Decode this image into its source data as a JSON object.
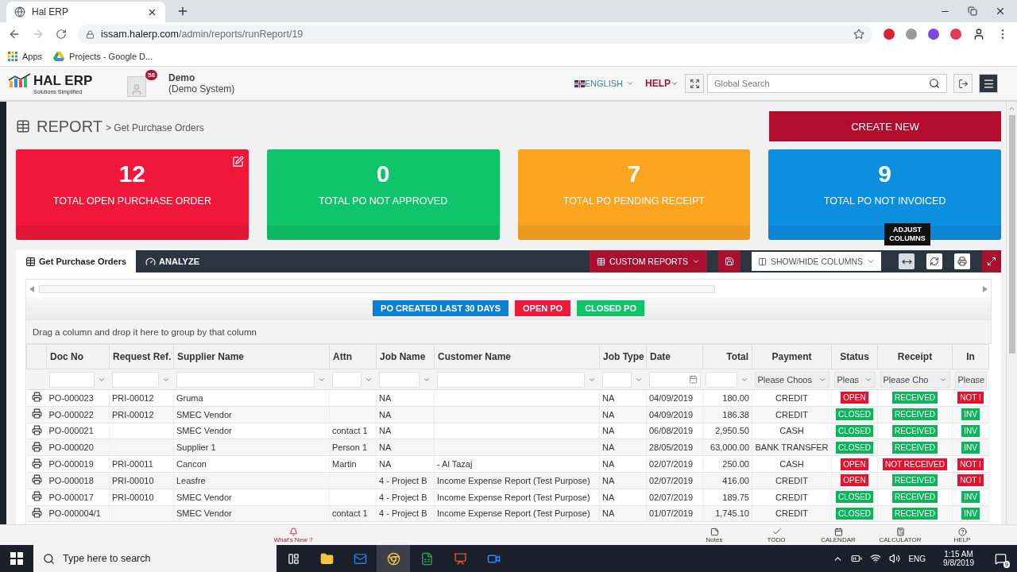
{
  "browser": {
    "tab_title": "Hal ERP",
    "url_host": "issam.halerp.com",
    "url_path": "/admin/reports/runReport/19",
    "bookmarks": [
      "Apps",
      "Projects - Google D..."
    ]
  },
  "header": {
    "logo": "HAL ERP",
    "logo_tagline": "Solutions Simplified",
    "notification_count": "58",
    "user_name": "Demo",
    "user_system": "(Demo System)",
    "language": "ENGLISH",
    "help": "HELP",
    "search": {
      "placeholder": "Global Search"
    }
  },
  "page": {
    "title": "REPORT",
    "breadcrumb": "> Get Purchase Orders",
    "create_button": "CREATE NEW"
  },
  "cards": [
    {
      "value": "12",
      "label": "TOTAL OPEN PURCHASE ORDER",
      "color": "#f0173a",
      "editable": true
    },
    {
      "value": "0",
      "label": "TOTAL PO NOT APPROVED",
      "color": "#0fc46a",
      "editable": false
    },
    {
      "value": "7",
      "label": "TOTAL PO PENDING RECEIPT",
      "color": "#fba41f",
      "editable": false
    },
    {
      "value": "9",
      "label": "TOTAL PO NOT INVOICED",
      "color": "#0d8fe0",
      "editable": false
    }
  ],
  "tabs": [
    {
      "label": "Get Purchase Orders",
      "selected": true
    },
    {
      "label": "ANALYZE",
      "selected": false
    }
  ],
  "toolbar": {
    "custom_reports": "CUSTOM REPORTS",
    "show_hide": "SHOW/HIDE COLUMNS",
    "tooltip": "ADJUST COLUMNS"
  },
  "quick_filters": [
    {
      "label": "PO CREATED LAST 30 DAYS",
      "color": "#0b7fd4"
    },
    {
      "label": "OPEN PO",
      "color": "#f0173a"
    },
    {
      "label": "CLOSED PO",
      "color": "#0fc46a"
    }
  ],
  "group_hint": "Drag a column and drop it here to group by that column",
  "columns": [
    {
      "label": "Doc No",
      "kind": "text",
      "filter": {
        "kind": "text"
      }
    },
    {
      "label": "Request Ref.",
      "kind": "text",
      "filter": {
        "kind": "text"
      }
    },
    {
      "label": "Supplier Name",
      "kind": "text",
      "filter": {
        "kind": "text"
      }
    },
    {
      "label": "Attn",
      "kind": "text",
      "filter": {
        "kind": "text"
      }
    },
    {
      "label": "Job Name",
      "kind": "text",
      "filter": {
        "kind": "text"
      }
    },
    {
      "label": "Customer Name",
      "kind": "text",
      "filter": {
        "kind": "text"
      }
    },
    {
      "label": "Job Type",
      "kind": "text",
      "filter": {
        "kind": "text"
      }
    },
    {
      "label": "Date",
      "kind": "text",
      "filter": {
        "kind": "date"
      }
    },
    {
      "label": "Total",
      "kind": "amount",
      "filter": {
        "kind": "text"
      }
    },
    {
      "label": "Payment",
      "kind": "choice",
      "filter": {
        "kind": "select",
        "placeholder": "Please Choos"
      }
    },
    {
      "label": "Status",
      "kind": "badge",
      "filter": {
        "kind": "select",
        "placeholder": "Pleas"
      }
    },
    {
      "label": "Receipt",
      "kind": "badge",
      "filter": {
        "kind": "select",
        "placeholder": "Please Cho"
      }
    },
    {
      "label": "In",
      "kind": "badge",
      "filter": {
        "kind": "select",
        "placeholder": "Please"
      }
    }
  ],
  "rows": [
    [
      "PO-000023",
      "PRI-00012",
      "Gruma",
      null,
      "NA",
      null,
      "NA",
      "04/09/2019",
      "180.00",
      "CREDIT",
      {
        "label": "OPEN",
        "color": "#e8112d"
      },
      {
        "label": "RECEIVED",
        "color": "#0db45b"
      },
      {
        "label": "NOT I",
        "color": "#e8112d"
      }
    ],
    [
      "PO-000022",
      "PRI-00012",
      "SMEC Vendor",
      null,
      "NA",
      null,
      "NA",
      "04/09/2019",
      "186.38",
      "CREDIT",
      {
        "label": "CLOSED",
        "color": "#0db45b"
      },
      {
        "label": "RECEIVED",
        "color": "#0db45b"
      },
      {
        "label": "INV",
        "color": "#0db45b"
      }
    ],
    [
      "PO-000021",
      null,
      "SMEC Vendor",
      "contact 1",
      "NA",
      null,
      "NA",
      "06/08/2019",
      "2,950.50",
      "CASH",
      {
        "label": "CLOSED",
        "color": "#0db45b"
      },
      {
        "label": "RECEIVED",
        "color": "#0db45b"
      },
      {
        "label": "INV",
        "color": "#0db45b"
      }
    ],
    [
      "PO-000020",
      null,
      "Supplier 1",
      "Person 1",
      "NA",
      null,
      "NA",
      "28/05/2019",
      "63,000.00",
      "BANK TRANSFER",
      {
        "label": "CLOSED",
        "color": "#0db45b"
      },
      {
        "label": "RECEIVED",
        "color": "#0db45b"
      },
      {
        "label": "INV",
        "color": "#0db45b"
      }
    ],
    [
      "PO-000019",
      "PRI-00011",
      "Cancon",
      "Martin",
      "NA",
      "- Al Tazaj",
      "NA",
      "02/07/2019",
      "250.00",
      "CASH",
      {
        "label": "OPEN",
        "color": "#e8112d"
      },
      {
        "label": "NOT RECEIVED",
        "color": "#e8112d"
      },
      {
        "label": "NOT I",
        "color": "#e8112d"
      }
    ],
    [
      "PO-000018",
      "PRI-00010",
      "Leasfre",
      null,
      "4 - Project B",
      "Income Expense Report (Test Purpose)",
      "NA",
      "02/07/2019",
      "416.00",
      "CREDIT",
      {
        "label": "OPEN",
        "color": "#e8112d"
      },
      {
        "label": "RECEIVED",
        "color": "#0db45b"
      },
      {
        "label": "NOT I",
        "color": "#e8112d"
      }
    ],
    [
      "PO-000017",
      "PRI-00010",
      "SMEC Vendor",
      null,
      "4 - Project B",
      "Income Expense Report (Test Purpose)",
      "NA",
      "02/07/2019",
      "189.75",
      "CREDIT",
      {
        "label": "CLOSED",
        "color": "#0db45b"
      },
      {
        "label": "RECEIVED",
        "color": "#0db45b"
      },
      {
        "label": "INV",
        "color": "#0db45b"
      }
    ],
    [
      "PO-000004/1",
      null,
      "SMEC Vendor",
      "contact 1",
      "4 - Project B",
      "Income Expense Report (Test Purpose)",
      "NA",
      "01/07/2019",
      "1,745.10",
      "CREDIT",
      {
        "label": "CLOSED",
        "color": "#0db45b"
      },
      {
        "label": "RECEIVED",
        "color": "#0db45b"
      },
      {
        "label": "INV",
        "color": "#0db45b"
      }
    ]
  ],
  "bottom_bar": {
    "whats_new": "What's New ?",
    "tools": [
      "Notes",
      "TODO",
      "CALENDAR",
      "CALCULATOR",
      "HELP"
    ]
  },
  "taskbar": {
    "search_placeholder": "Type here to search",
    "language": "ENG",
    "time": "1:15 AM",
    "date": "9/8/2019",
    "notifications": "9"
  }
}
